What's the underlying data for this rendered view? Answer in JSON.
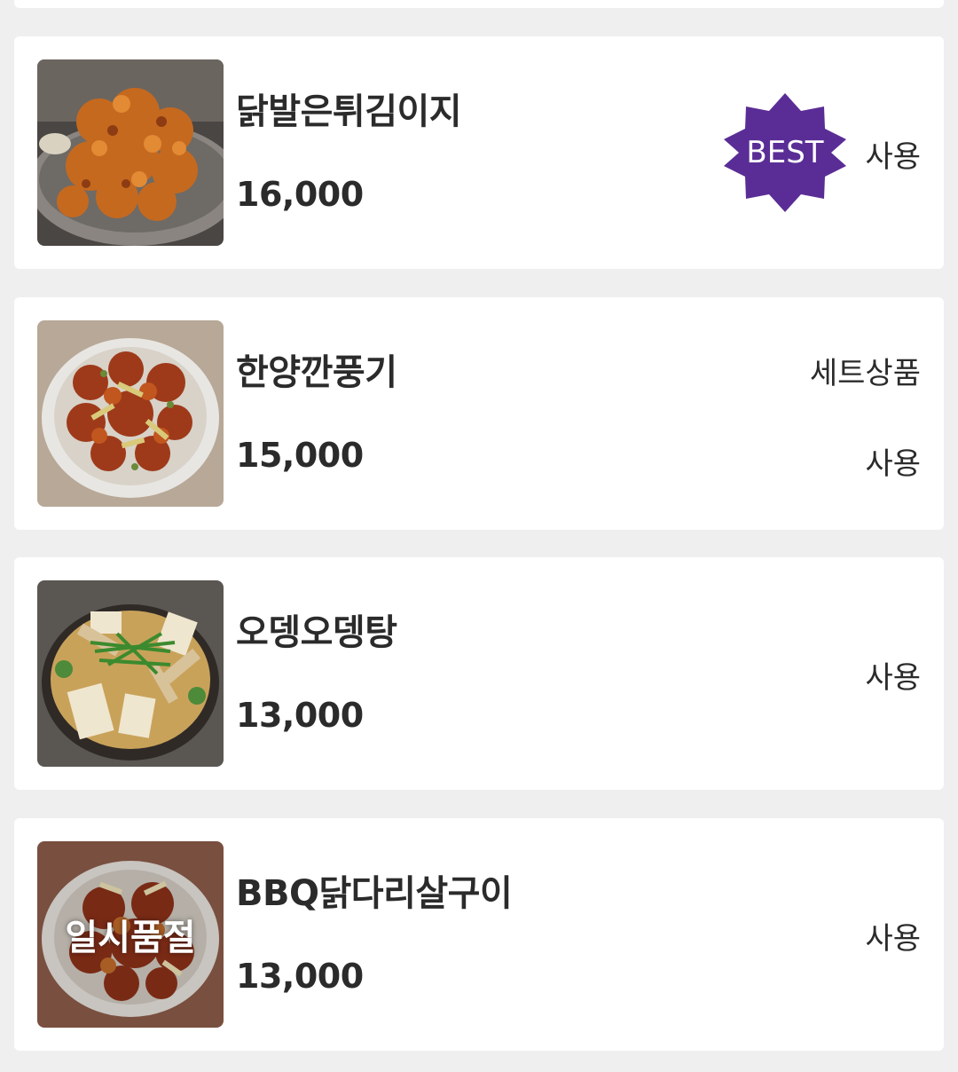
{
  "menu_items": [
    {
      "name": "닭발은튀김이지",
      "price": "16,000",
      "badge": "BEST",
      "status": "사용",
      "set_label": "",
      "sold_out_label": "",
      "image_icon": "fried-chicken-feet-photo"
    },
    {
      "name": "한양깐풍기",
      "price": "15,000",
      "badge": "",
      "status": "사용",
      "set_label": "세트상품",
      "sold_out_label": "",
      "image_icon": "kkanpunggi-photo"
    },
    {
      "name": "오뎅오뎅탕",
      "price": "13,000",
      "badge": "",
      "status": "사용",
      "set_label": "",
      "sold_out_label": "",
      "image_icon": "fishcake-soup-photo"
    },
    {
      "name": "BBQ닭다리살구이",
      "price": "13,000",
      "badge": "",
      "status": "사용",
      "set_label": "",
      "sold_out_label": "일시품절",
      "image_icon": "bbq-chicken-thigh-photo"
    }
  ],
  "colors": {
    "background": "#efefef",
    "card": "#ffffff",
    "best_badge": "#5a2d96",
    "text": "#2b2b2b"
  }
}
